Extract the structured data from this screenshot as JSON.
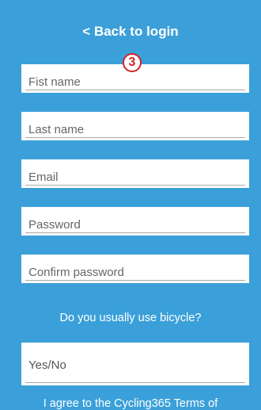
{
  "header": {
    "back_label": "< Back to login"
  },
  "step_badge": "3",
  "form": {
    "first_name_placeholder": "Fist name",
    "last_name_placeholder": "Last name",
    "email_placeholder": "Email",
    "password_placeholder": "Password",
    "confirm_password_placeholder": "Confirm password",
    "bicycle_question": "Do you usually use bicycle?",
    "bicycle_value": "Yes/No",
    "terms_text": "I agree to the Cycling365 Terms of"
  },
  "colors": {
    "background": "#3ba0d9",
    "field_background": "#ffffff",
    "badge": "#d22424"
  }
}
